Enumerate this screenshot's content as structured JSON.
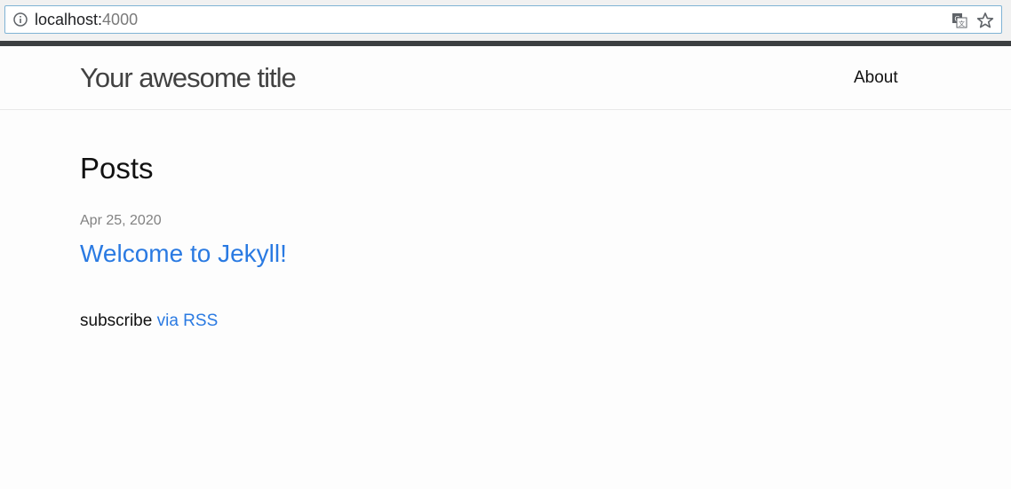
{
  "browser": {
    "url_host": "localhost:",
    "url_port": "4000",
    "icons": {
      "info": "info-icon",
      "translate": "translate-icon",
      "bookmark": "star-icon"
    },
    "colors": {
      "toolbar": "#f1f1f1",
      "address_border": "#7fb3d5",
      "strip": "#3c3f41"
    }
  },
  "header": {
    "site_title": "Your awesome title",
    "nav": [
      {
        "label": "About"
      }
    ]
  },
  "main": {
    "heading": "Posts",
    "posts": [
      {
        "date": "Apr 25, 2020",
        "title": "Welcome to Jekyll!"
      }
    ],
    "rss_prefix": "subscribe",
    "rss_link": "via RSS"
  },
  "colors": {
    "link": "#2a7ae2",
    "meta": "#828282",
    "background": "#fdfdfd"
  }
}
